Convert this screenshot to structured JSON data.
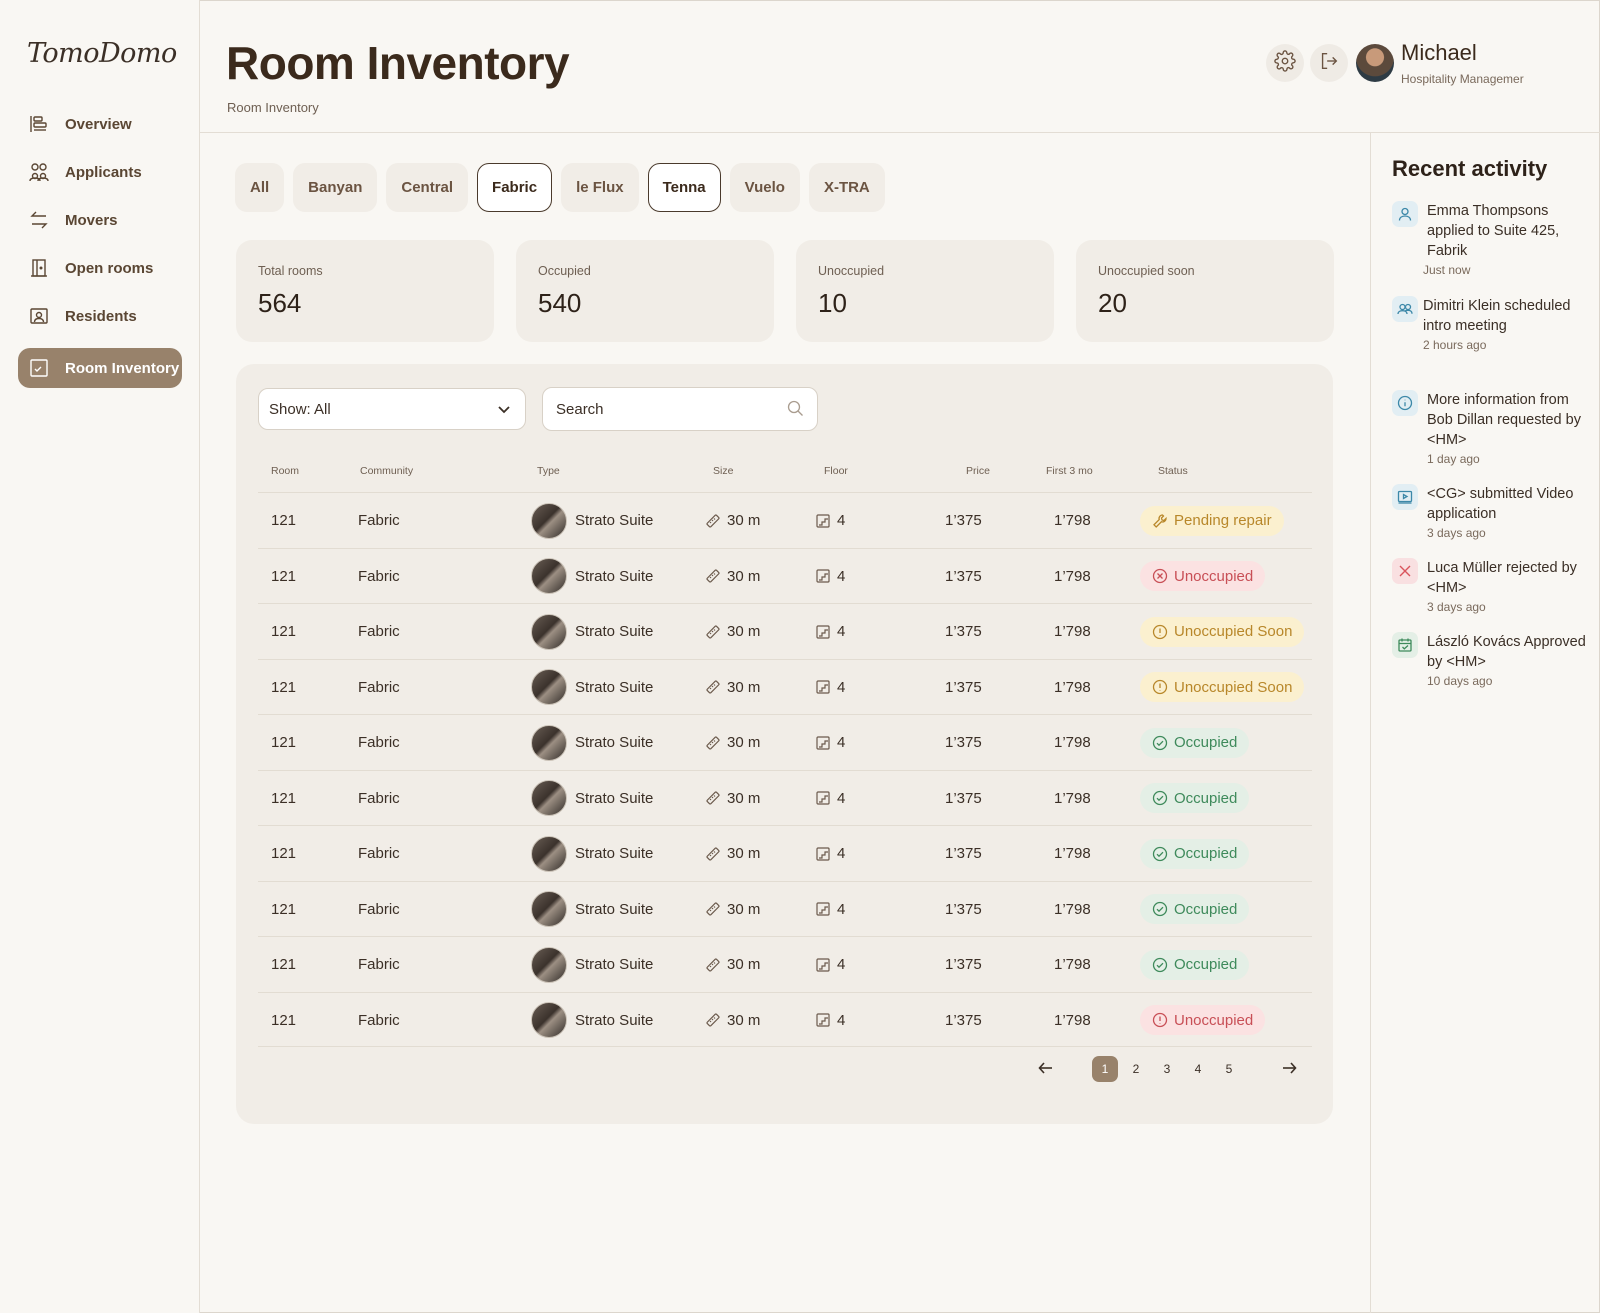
{
  "brand": {
    "logo": "TomoDomo"
  },
  "sidebar": {
    "items": [
      {
        "label": "Overview",
        "icon": "overview-icon"
      },
      {
        "label": "Applicants",
        "icon": "users-icon"
      },
      {
        "label": "Movers",
        "icon": "swap-arrows-icon"
      },
      {
        "label": "Open rooms",
        "icon": "door-icon"
      },
      {
        "label": "Residents",
        "icon": "resident-card-icon"
      },
      {
        "label": "Room Inventory",
        "icon": "inventory-icon",
        "active": true
      }
    ]
  },
  "header": {
    "title": "Room Inventory",
    "breadcrumb": "Room Inventory",
    "user": {
      "name": "Michael",
      "role": "Hospitality Managemer"
    }
  },
  "tabs": [
    "All",
    "Banyan",
    "Central",
    "Fabric",
    "le Flux",
    "Tenna",
    "Vuelo",
    "X-TRA"
  ],
  "selected_tabs": [
    "Fabric",
    "Tenna"
  ],
  "stats": [
    {
      "label": "Total rooms",
      "value": "564"
    },
    {
      "label": "Occupied",
      "value": "540"
    },
    {
      "label": "Unoccupied",
      "value": "10"
    },
    {
      "label": "Unoccupied soon",
      "value": "20"
    }
  ],
  "filters": {
    "show": "Show: All",
    "search_placeholder": "Search"
  },
  "table": {
    "headers": [
      "Room",
      "Community",
      "Type",
      "Size",
      "Floor",
      "Price",
      "First 3 mo",
      "Status"
    ],
    "rows": [
      {
        "room": "121",
        "community": "Fabric",
        "type": "Strato Suite",
        "size": "30 m",
        "floor": "4",
        "price": "1’375",
        "first3": "1’798",
        "status": "Pending repair",
        "status_kind": "repair"
      },
      {
        "room": "121",
        "community": "Fabric",
        "type": "Strato Suite",
        "size": "30 m",
        "floor": "4",
        "price": "1’375",
        "first3": "1’798",
        "status": "Unoccupied",
        "status_kind": "unocc-x"
      },
      {
        "room": "121",
        "community": "Fabric",
        "type": "Strato Suite",
        "size": "30 m",
        "floor": "4",
        "price": "1’375",
        "first3": "1’798",
        "status": "Unoccupied Soon",
        "status_kind": "soon"
      },
      {
        "room": "121",
        "community": "Fabric",
        "type": "Strato Suite",
        "size": "30 m",
        "floor": "4",
        "price": "1’375",
        "first3": "1’798",
        "status": "Unoccupied Soon",
        "status_kind": "soon"
      },
      {
        "room": "121",
        "community": "Fabric",
        "type": "Strato Suite",
        "size": "30 m",
        "floor": "4",
        "price": "1’375",
        "first3": "1’798",
        "status": "Occupied",
        "status_kind": "occ"
      },
      {
        "room": "121",
        "community": "Fabric",
        "type": "Strato Suite",
        "size": "30 m",
        "floor": "4",
        "price": "1’375",
        "first3": "1’798",
        "status": "Occupied",
        "status_kind": "occ"
      },
      {
        "room": "121",
        "community": "Fabric",
        "type": "Strato Suite",
        "size": "30 m",
        "floor": "4",
        "price": "1’375",
        "first3": "1’798",
        "status": "Occupied",
        "status_kind": "occ"
      },
      {
        "room": "121",
        "community": "Fabric",
        "type": "Strato Suite",
        "size": "30 m",
        "floor": "4",
        "price": "1’375",
        "first3": "1’798",
        "status": "Occupied",
        "status_kind": "occ"
      },
      {
        "room": "121",
        "community": "Fabric",
        "type": "Strato Suite",
        "size": "30 m",
        "floor": "4",
        "price": "1’375",
        "first3": "1’798",
        "status": "Occupied",
        "status_kind": "occ"
      },
      {
        "room": "121",
        "community": "Fabric",
        "type": "Strato Suite",
        "size": "30 m",
        "floor": "4",
        "price": "1’375",
        "first3": "1’798",
        "status": "Unoccupied",
        "status_kind": "unocc-excl"
      }
    ]
  },
  "pagination": {
    "pages": [
      "1",
      "2",
      "3",
      "4",
      "5"
    ],
    "current": "1"
  },
  "activity": {
    "title": "Recent activity",
    "items": [
      {
        "text": "Emma Thompsons applied to Suite 425, Fabrik",
        "time": "Just now",
        "icon": "user-icon",
        "color": "#3c88a8"
      },
      {
        "text": "Dimitri Klein scheduled intro meeting",
        "time": "2 hours ago",
        "icon": "users-icon",
        "color": "#3c88a8"
      },
      {
        "text": "More information from Bob Dillan requested by <HM>",
        "time": "1 day ago",
        "icon": "info-icon",
        "color": "#3c88a8"
      },
      {
        "text": "<CG> submitted Video application",
        "time": "3 days ago",
        "icon": "video-icon",
        "color": "#3c88a8"
      },
      {
        "text": "Luca Müller rejected by <HM>",
        "time": "3 days ago",
        "icon": "x-icon",
        "color": "#d9545c"
      },
      {
        "text": "László Kovács Approved by <HM>",
        "time": "10 days ago",
        "icon": "calendar-check-icon",
        "color": "#3e8a5b"
      }
    ]
  },
  "colors": {
    "accent": "#98826b",
    "occupied": "#3e8a5b",
    "unoccupied": "#c84f56",
    "pending": "#b8872a"
  }
}
